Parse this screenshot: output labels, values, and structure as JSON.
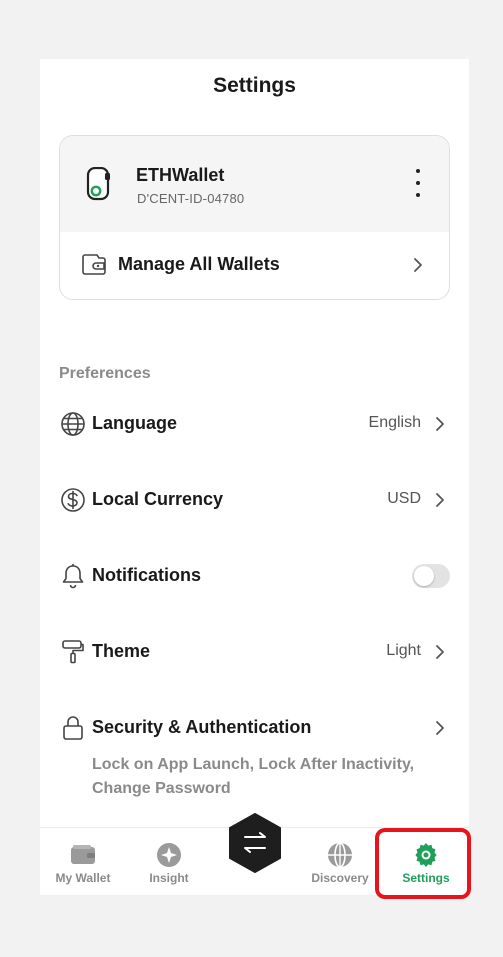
{
  "page": {
    "title": "Settings"
  },
  "wallet": {
    "name": "ETHWallet",
    "id": "D'CENT-ID-04780",
    "manage_label": "Manage All Wallets"
  },
  "preferences": {
    "section_label": "Preferences",
    "items": [
      {
        "label": "Language",
        "value": "English",
        "icon": "globe-icon"
      },
      {
        "label": "Local Currency",
        "value": "USD",
        "icon": "dollar-icon"
      },
      {
        "label": "Notifications",
        "toggle_on": false,
        "icon": "bell-icon"
      },
      {
        "label": "Theme",
        "value": "Light",
        "icon": "paint-roller-icon"
      },
      {
        "label": "Security & Authentication",
        "subtitle": "Lock on App Launch, Lock After Inactivity, Change Password",
        "icon": "lock-icon"
      }
    ]
  },
  "tabbar": {
    "tabs": [
      {
        "label": "My Wallet",
        "icon": "wallet-icon",
        "active": false
      },
      {
        "label": "Insight",
        "icon": "sparkle-icon",
        "active": false
      },
      {
        "label": "Discovery",
        "icon": "globe-icon",
        "active": false
      },
      {
        "label": "Settings",
        "icon": "gear-icon",
        "active": true
      }
    ],
    "center_icon": "swap-icon"
  },
  "colors": {
    "accent": "#1fa05a",
    "highlight": "#e8141c",
    "muted": "#8a8a8a"
  }
}
